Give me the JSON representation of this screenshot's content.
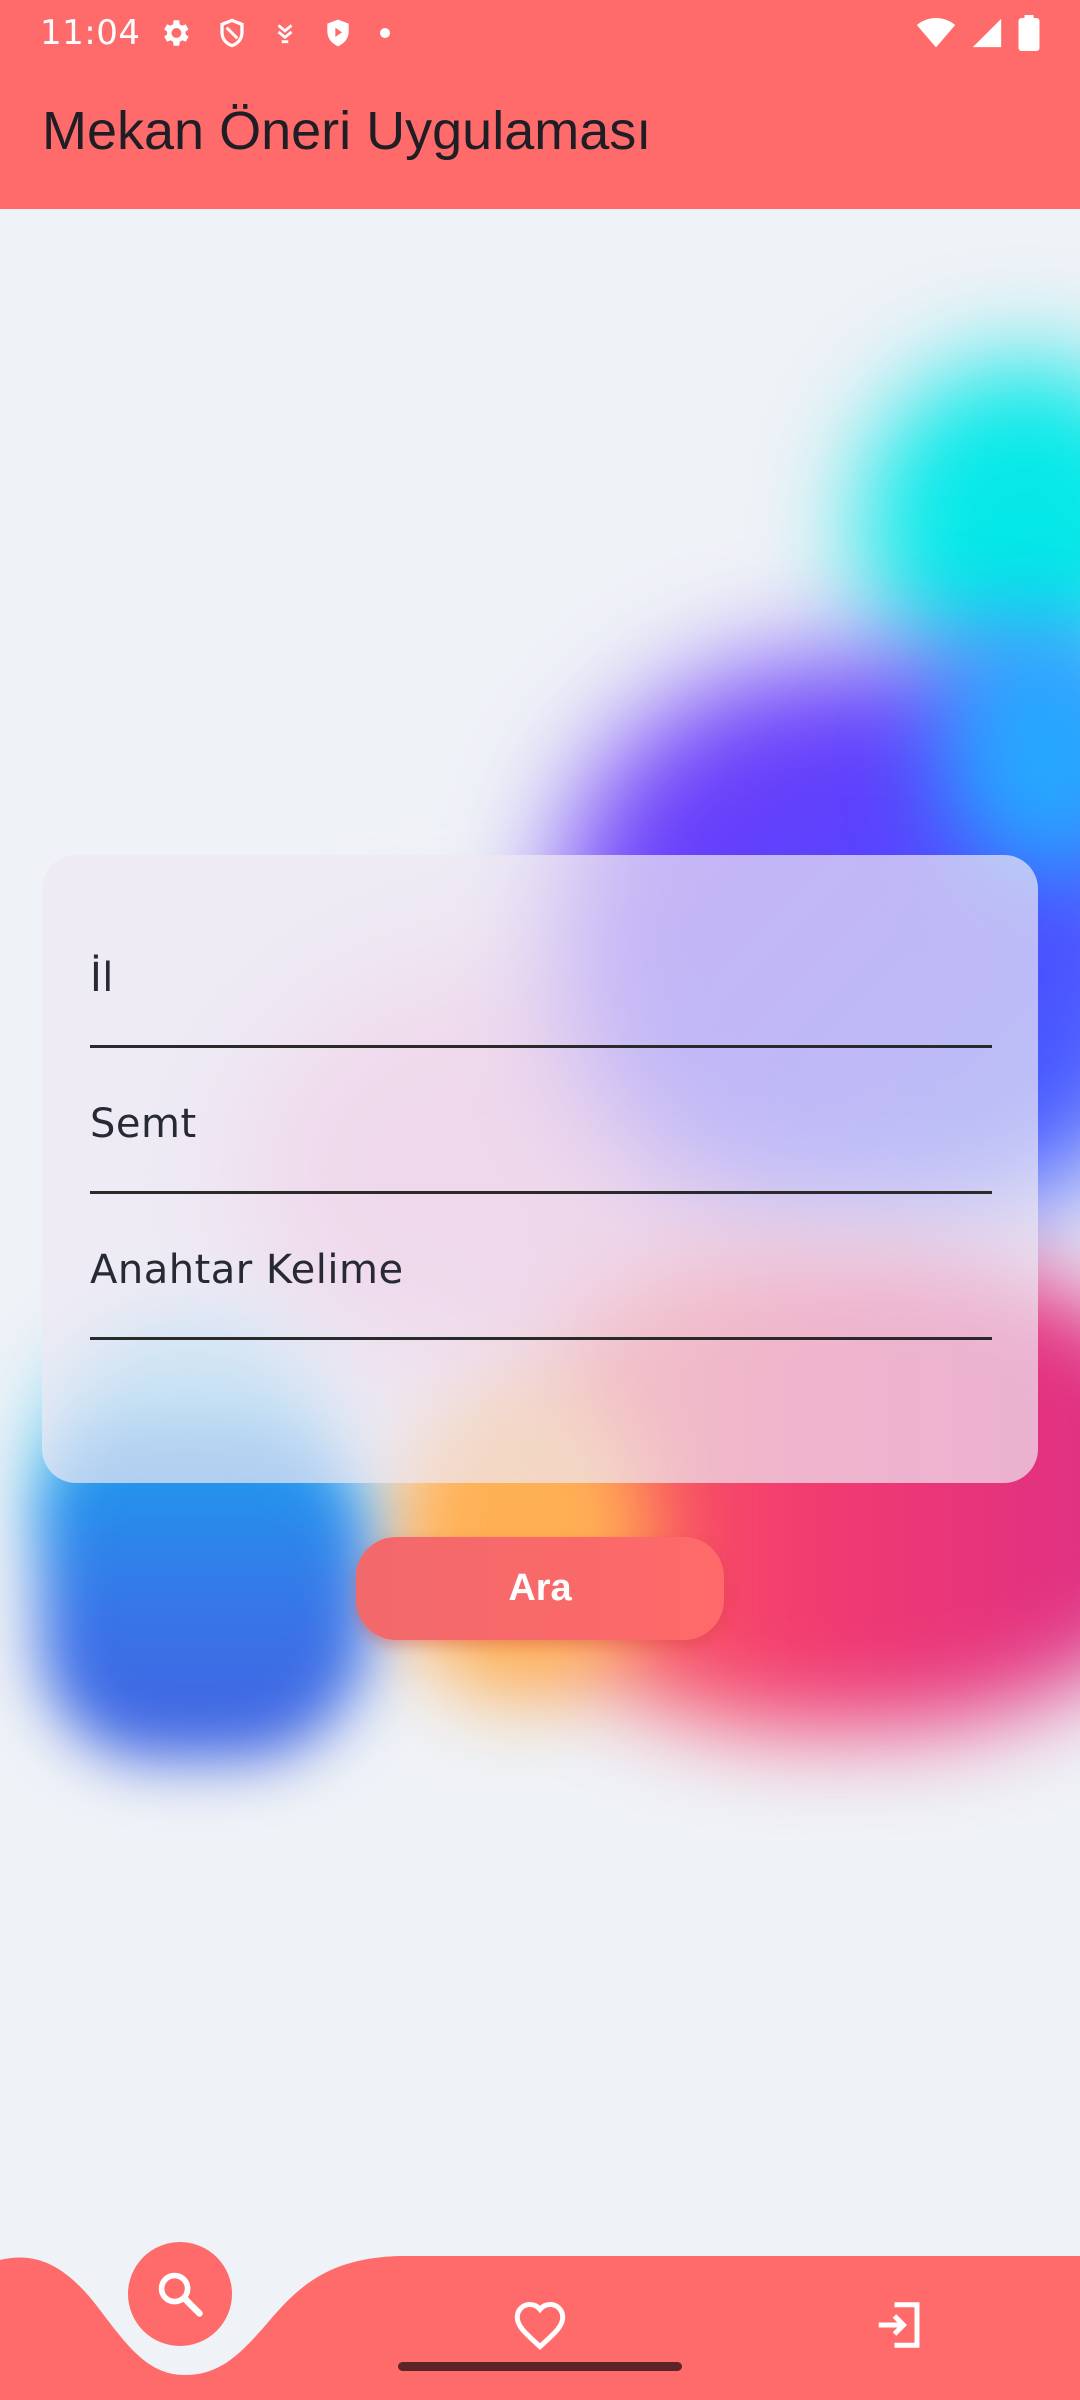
{
  "status_bar": {
    "time": "11:04",
    "left_icons": [
      "gear-icon",
      "shield-icon",
      "download-icon",
      "play-shield-icon",
      "dot-icon"
    ],
    "right_icons": [
      "wifi-icon",
      "signal-icon",
      "battery-icon"
    ]
  },
  "app_bar": {
    "title": "Mekan Öneri Uygulaması"
  },
  "form": {
    "city_label": "İl",
    "district_label": "Semt",
    "keyword_label": "Anahtar Kelime"
  },
  "search_button": {
    "label": "Ara"
  },
  "bottom_nav": {
    "items": [
      {
        "icon": "search-icon",
        "active": true
      },
      {
        "icon": "heart-icon",
        "active": false
      },
      {
        "icon": "logout-icon",
        "active": false
      }
    ]
  },
  "colors": {
    "primary": "#ff6b6b",
    "background": "#eff2f7",
    "text": "#1e1e24"
  }
}
